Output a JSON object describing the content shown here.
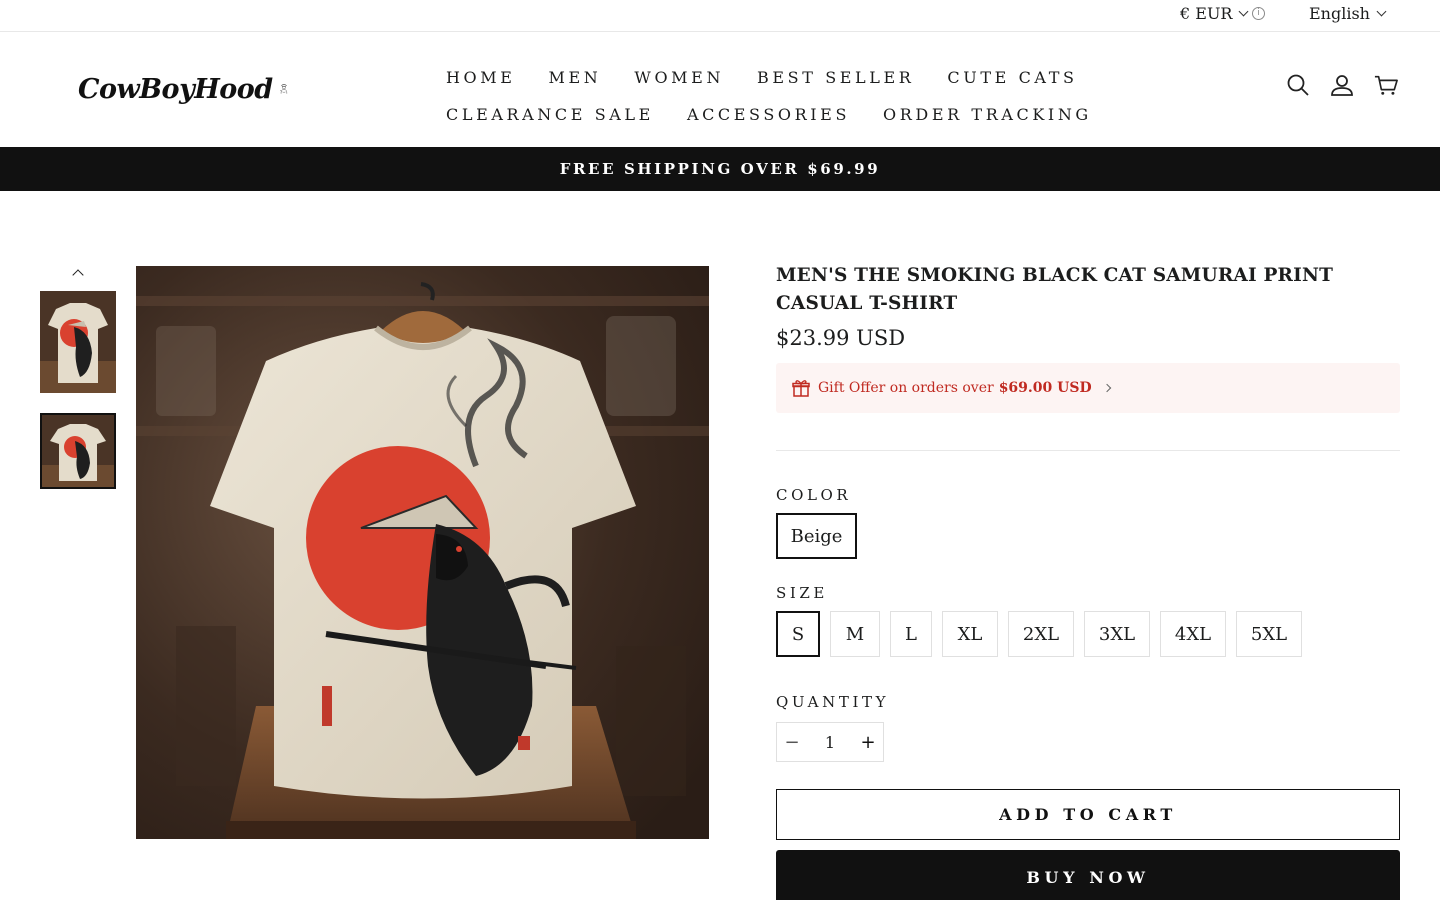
{
  "utility": {
    "currency": "€ EUR",
    "language": "English"
  },
  "header": {
    "logo_text": "CowBoyHood",
    "nav_row1": [
      "HOME",
      "MEN",
      "WOMEN",
      "BEST SELLER",
      "CUTE CATS"
    ],
    "nav_row2": [
      "CLEARANCE SALE",
      "ACCESSORIES",
      "ORDER TRACKING"
    ],
    "icons": [
      "search-icon",
      "account-icon",
      "cart-icon"
    ]
  },
  "announcement": "FREE SHIPPING OVER $69.99",
  "product": {
    "title": "MEN'S THE SMOKING BLACK CAT SAMURAI PRINT CASUAL T-SHIRT",
    "price": "$23.99 USD",
    "gift_text": "Gift Offer on orders over",
    "gift_amount": "$69.00 USD",
    "color_label": "COLOR",
    "colors": [
      "Beige"
    ],
    "selected_color": "Beige",
    "size_label": "SIZE",
    "sizes": [
      "S",
      "M",
      "L",
      "XL",
      "2XL",
      "3XL",
      "4XL",
      "5XL"
    ],
    "selected_size": "S",
    "quantity_label": "QUANTITY",
    "quantity": "1",
    "add_to_cart": "ADD TO CART",
    "buy_now": "BUY NOW"
  },
  "colors": {
    "announcement_bg": "#111111",
    "gift_bg": "#fdf4f3",
    "gift_text": "#c02a21",
    "paypal_yellow": "#ffc439",
    "print_red": "#d9412f",
    "shirt_beige": "#e4dccb"
  }
}
